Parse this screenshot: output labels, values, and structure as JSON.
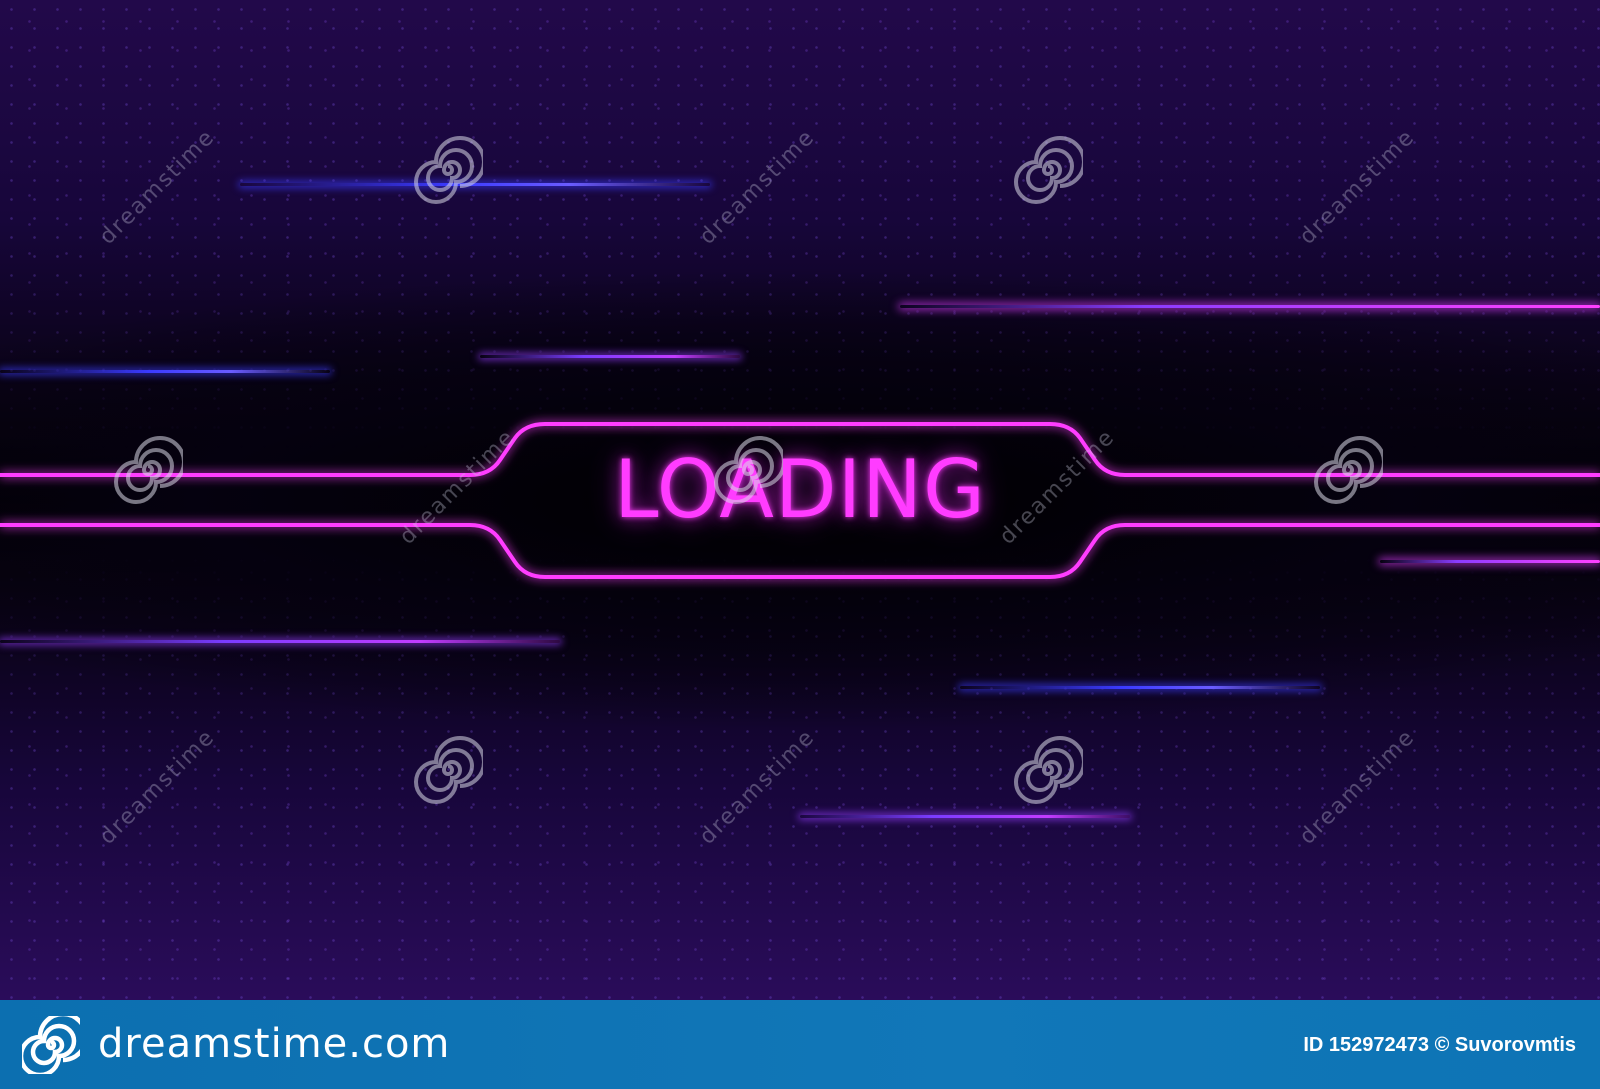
{
  "center": {
    "loading_text": "LOADING"
  },
  "watermark": {
    "text": "dreamstime",
    "icon": "swirl-icon"
  },
  "footer": {
    "logo_text": "dreamstime.com",
    "logo_icon": "swirl-icon",
    "image_id": "ID 152972473 © Suvorovmtis"
  },
  "colors": {
    "neon_pink": "#ff3cff",
    "neon_blue": "#3a3aff",
    "background": "#12042a",
    "footer_bar": "#1177b8"
  }
}
